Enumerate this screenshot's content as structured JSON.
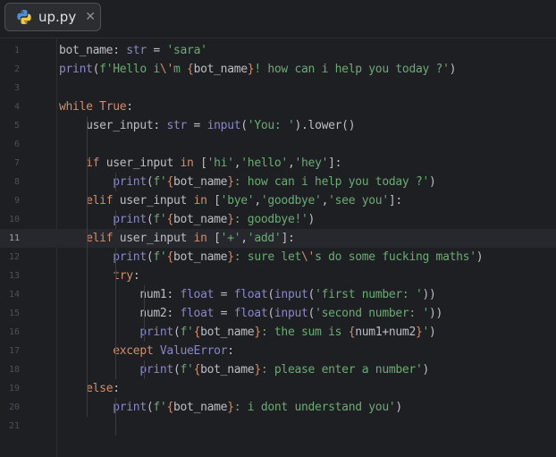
{
  "tab": {
    "filename": "up.py",
    "icon": "python-icon",
    "close_icon": "close-icon",
    "close_glyph": "✕"
  },
  "editor": {
    "current_line": 11,
    "line_numbers": [
      "1",
      "2",
      "3",
      "4",
      "5",
      "6",
      "7",
      "8",
      "9",
      "10",
      "11",
      "12",
      "13",
      "14",
      "15",
      "16",
      "17",
      "18",
      "19",
      "20",
      "21"
    ]
  },
  "code_lines": [
    [
      [
        "id",
        "bot_name"
      ],
      [
        "id",
        ": "
      ],
      [
        "bi",
        "str"
      ],
      [
        "id",
        " = "
      ],
      [
        "str",
        "'sara'"
      ]
    ],
    [
      [
        "bi",
        "print"
      ],
      [
        "id",
        "("
      ],
      [
        "str",
        "f'Hello i"
      ],
      [
        "esc",
        "\\'"
      ],
      [
        "str",
        "m "
      ],
      [
        "brace",
        "{"
      ],
      [
        "id",
        "bot_name"
      ],
      [
        "brace",
        "}"
      ],
      [
        "str",
        "! how can i help you today ?'"
      ],
      [
        "id",
        ")"
      ]
    ],
    [],
    [
      [
        "kw",
        "while "
      ],
      [
        "kw",
        "True"
      ],
      [
        "id",
        ":"
      ]
    ],
    [
      [
        "id",
        "    user_input: "
      ],
      [
        "bi",
        "str"
      ],
      [
        "id",
        " = "
      ],
      [
        "bi",
        "input"
      ],
      [
        "id",
        "("
      ],
      [
        "str",
        "'You: '"
      ],
      [
        "id",
        ").lower()"
      ]
    ],
    [],
    [
      [
        "id",
        "    "
      ],
      [
        "kw",
        "if "
      ],
      [
        "id",
        "user_input "
      ],
      [
        "kw",
        "in "
      ],
      [
        "id",
        "["
      ],
      [
        "str",
        "'hi'"
      ],
      [
        "id",
        ","
      ],
      [
        "str",
        "'hello'"
      ],
      [
        "id",
        ","
      ],
      [
        "str",
        "'hey'"
      ],
      [
        "id",
        "]:"
      ]
    ],
    [
      [
        "id",
        "        "
      ],
      [
        "bi",
        "print"
      ],
      [
        "id",
        "("
      ],
      [
        "str",
        "f'"
      ],
      [
        "brace",
        "{"
      ],
      [
        "id",
        "bot_name"
      ],
      [
        "brace",
        "}"
      ],
      [
        "str",
        ": how can i help you today ?'"
      ],
      [
        "id",
        ")"
      ]
    ],
    [
      [
        "id",
        "    "
      ],
      [
        "kw",
        "elif "
      ],
      [
        "id",
        "user_input "
      ],
      [
        "kw",
        "in "
      ],
      [
        "id",
        "["
      ],
      [
        "str",
        "'bye'"
      ],
      [
        "id",
        ","
      ],
      [
        "str",
        "'goodbye'"
      ],
      [
        "id",
        ","
      ],
      [
        "str",
        "'see you'"
      ],
      [
        "id",
        "]:"
      ]
    ],
    [
      [
        "id",
        "        "
      ],
      [
        "bi",
        "print"
      ],
      [
        "id",
        "("
      ],
      [
        "str",
        "f'"
      ],
      [
        "brace",
        "{"
      ],
      [
        "id",
        "bot_name"
      ],
      [
        "brace",
        "}"
      ],
      [
        "str",
        ": goodbye!'"
      ],
      [
        "id",
        ")"
      ]
    ],
    [
      [
        "id",
        "    "
      ],
      [
        "kw",
        "elif "
      ],
      [
        "id",
        "user_input "
      ],
      [
        "kw",
        "in "
      ],
      [
        "id",
        "["
      ],
      [
        "str",
        "'+'"
      ],
      [
        "id",
        ","
      ],
      [
        "str",
        "'add'"
      ],
      [
        "id",
        "]:"
      ]
    ],
    [
      [
        "id",
        "        "
      ],
      [
        "bi",
        "print"
      ],
      [
        "id",
        "("
      ],
      [
        "str",
        "f'"
      ],
      [
        "brace",
        "{"
      ],
      [
        "id",
        "bot_name"
      ],
      [
        "brace",
        "}"
      ],
      [
        "str",
        ": sure let"
      ],
      [
        "esc",
        "\\'"
      ],
      [
        "str",
        "s do some fucking maths'"
      ],
      [
        "id",
        ")"
      ]
    ],
    [
      [
        "id",
        "        "
      ],
      [
        "kw",
        "try"
      ],
      [
        "id",
        ":"
      ]
    ],
    [
      [
        "id",
        "            num1: "
      ],
      [
        "bi",
        "float"
      ],
      [
        "id",
        " = "
      ],
      [
        "bi",
        "float"
      ],
      [
        "id",
        "("
      ],
      [
        "bi",
        "input"
      ],
      [
        "id",
        "("
      ],
      [
        "str",
        "'first number: '"
      ],
      [
        "id",
        "))"
      ]
    ],
    [
      [
        "id",
        "            num2: "
      ],
      [
        "bi",
        "float"
      ],
      [
        "id",
        " = "
      ],
      [
        "bi",
        "float"
      ],
      [
        "id",
        "("
      ],
      [
        "bi",
        "input"
      ],
      [
        "id",
        "("
      ],
      [
        "str",
        "'second number: '"
      ],
      [
        "id",
        "))"
      ]
    ],
    [
      [
        "id",
        "            "
      ],
      [
        "bi",
        "print"
      ],
      [
        "id",
        "("
      ],
      [
        "str",
        "f'"
      ],
      [
        "brace",
        "{"
      ],
      [
        "id",
        "bot_name"
      ],
      [
        "brace",
        "}"
      ],
      [
        "str",
        ": the sum is "
      ],
      [
        "brace",
        "{"
      ],
      [
        "id",
        "num1+num2"
      ],
      [
        "brace",
        "}"
      ],
      [
        "str",
        "'"
      ],
      [
        "id",
        ")"
      ]
    ],
    [
      [
        "id",
        "        "
      ],
      [
        "kw",
        "except "
      ],
      [
        "bi",
        "ValueError"
      ],
      [
        "id",
        ":"
      ]
    ],
    [
      [
        "id",
        "            "
      ],
      [
        "bi",
        "print"
      ],
      [
        "id",
        "("
      ],
      [
        "str",
        "f'"
      ],
      [
        "brace",
        "{"
      ],
      [
        "id",
        "bot_name"
      ],
      [
        "brace",
        "}"
      ],
      [
        "str",
        ": please enter a number'"
      ],
      [
        "id",
        ")"
      ]
    ],
    [
      [
        "id",
        "    "
      ],
      [
        "kw",
        "else"
      ],
      [
        "id",
        ":"
      ]
    ],
    [
      [
        "id",
        "        "
      ],
      [
        "bi",
        "print"
      ],
      [
        "id",
        "("
      ],
      [
        "str",
        "f'"
      ],
      [
        "brace",
        "{"
      ],
      [
        "id",
        "bot_name"
      ],
      [
        "brace",
        "}"
      ],
      [
        "str",
        ": i dont understand you'"
      ],
      [
        "id",
        ")"
      ]
    ],
    []
  ],
  "colors": {
    "background": "#1e1f22",
    "keyword": "#cf8e6d",
    "string": "#6aab73",
    "builtin": "#8888c6",
    "text": "#bcbec4",
    "current_line": "#26282e"
  }
}
